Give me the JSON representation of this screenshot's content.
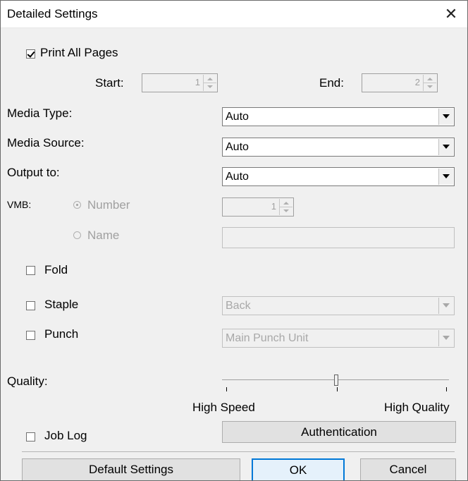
{
  "window": {
    "title": "Detailed Settings",
    "close_symbol": "✕"
  },
  "print_all_pages": {
    "label": "Print All Pages",
    "checked": true
  },
  "start": {
    "label": "Start:",
    "value": "1"
  },
  "end": {
    "label": "End:",
    "value": "2"
  },
  "media_type": {
    "label": "Media Type:",
    "value": "Auto"
  },
  "media_source": {
    "label": "Media Source:",
    "value": "Auto"
  },
  "output_to": {
    "label": "Output to:",
    "value": "Auto"
  },
  "vmb": {
    "label": "VMB:",
    "number_label": "Number",
    "number_value": "1",
    "name_label": "Name",
    "name_value": ""
  },
  "fold": {
    "label": "Fold",
    "checked": false
  },
  "staple": {
    "label": "Staple",
    "checked": false,
    "value": "Back"
  },
  "punch": {
    "label": "Punch",
    "checked": false,
    "value": "Main Punch Unit"
  },
  "quality": {
    "label": "Quality:",
    "min_label": "High Speed",
    "max_label": "High Quality",
    "level": 0.5
  },
  "job_log": {
    "label": "Job Log",
    "checked": false
  },
  "buttons": {
    "authentication": "Authentication",
    "default_settings": "Default Settings",
    "ok": "OK",
    "cancel": "Cancel"
  }
}
